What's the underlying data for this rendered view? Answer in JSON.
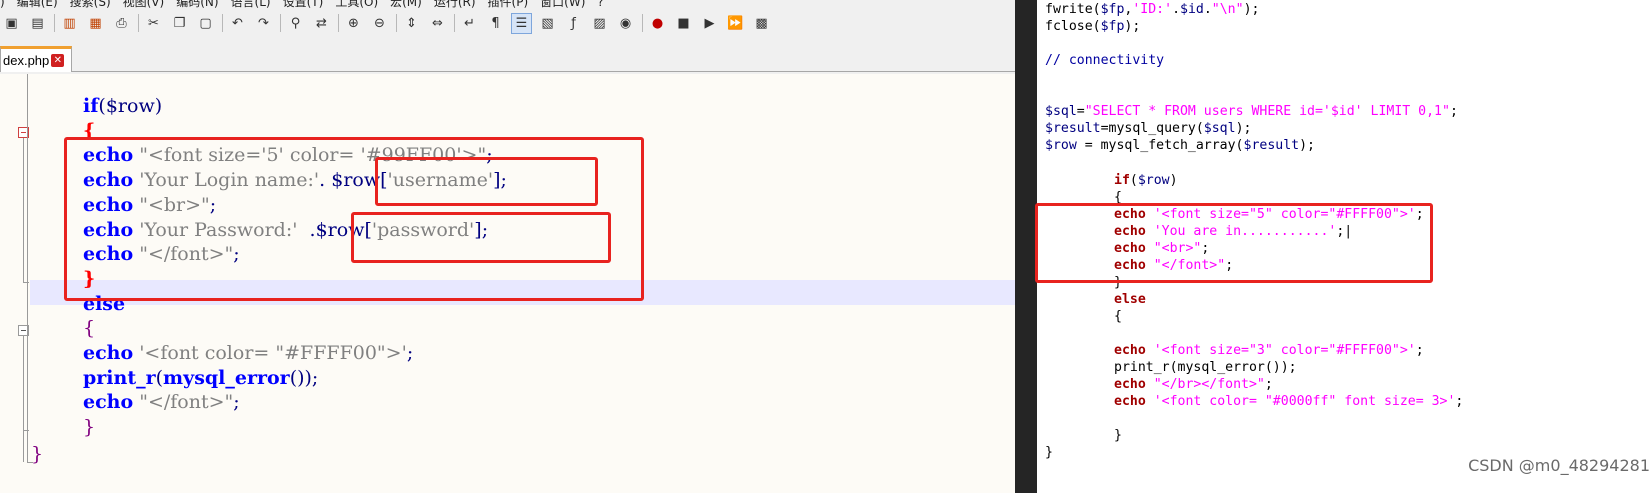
{
  "menubar": {
    "items": [
      ")",
      "编辑(E)",
      "搜索(S)",
      "视图(V)",
      "编码(N)",
      "语言(L)",
      "设置(T)",
      "工具(O)",
      "宏(M)",
      "运行(R)",
      "插件(P)",
      "窗口(W)",
      "?"
    ]
  },
  "toolbar": {
    "icons": [
      "save-icon",
      "save-all-icon",
      "close-icon",
      "close-all-icon",
      "print-icon",
      "cut-icon",
      "copy-icon",
      "paste-icon",
      "undo-icon",
      "redo-icon",
      "find-icon",
      "replace-icon",
      "zoom-in-icon",
      "zoom-out-icon",
      "sync-vertical-icon",
      "sync-horizontal-icon",
      "word-wrap-icon",
      "show-all-chars-icon",
      "indent-guide-icon",
      "doc-map-icon",
      "function-list-icon",
      "folder-workspace-icon",
      "monitor-icon",
      "record-macro-icon",
      "stop-macro-icon",
      "play-macro-icon",
      "run-macro-multiple-icon",
      "save-macro-icon"
    ]
  },
  "tab": {
    "label": "dex.php"
  },
  "editor": {
    "lines": [
      {
        "indent": "",
        "parts": [
          [
            "kw",
            "if"
          ],
          [
            "op",
            "("
          ],
          [
            "var",
            "$row"
          ],
          [
            "op",
            ")"
          ]
        ]
      },
      {
        "indent": "",
        "parts": [
          [
            "brace-red",
            "{"
          ]
        ]
      },
      {
        "indent": "",
        "parts": [
          [
            "kw",
            "echo"
          ],
          [
            "op",
            " "
          ],
          [
            "str",
            "\"<font size='5' color= '#99FF00'>\""
          ],
          [
            "op",
            ";"
          ]
        ]
      },
      {
        "indent": "",
        "parts": [
          [
            "kw",
            "echo"
          ],
          [
            "op",
            " "
          ],
          [
            "str",
            "'Your Login name:'"
          ],
          [
            "op",
            ". "
          ],
          [
            "var",
            "$row"
          ],
          [
            "op",
            "["
          ],
          [
            "str",
            "'username'"
          ],
          [
            "op",
            "];"
          ]
        ]
      },
      {
        "indent": "",
        "parts": [
          [
            "kw",
            "echo"
          ],
          [
            "op",
            " "
          ],
          [
            "str",
            "\"<br>\""
          ],
          [
            "op",
            ";"
          ]
        ]
      },
      {
        "indent": "",
        "parts": [
          [
            "kw",
            "echo"
          ],
          [
            "op",
            " "
          ],
          [
            "str",
            "'Your Password:' "
          ],
          [
            "op",
            " ."
          ],
          [
            "var",
            "$row"
          ],
          [
            "op",
            "["
          ],
          [
            "str",
            "'password'"
          ],
          [
            "op",
            "];"
          ]
        ]
      },
      {
        "indent": "",
        "parts": [
          [
            "kw",
            "echo"
          ],
          [
            "op",
            " "
          ],
          [
            "str",
            "\"</font>\""
          ],
          [
            "op",
            ";"
          ]
        ]
      },
      {
        "indent": "",
        "parts": [
          [
            "brace-red",
            "}"
          ]
        ]
      },
      {
        "indent": "",
        "parts": [
          [
            "kw",
            "else"
          ]
        ]
      },
      {
        "indent": "",
        "parts": [
          [
            "brace",
            "{"
          ]
        ]
      },
      {
        "indent": "",
        "parts": [
          [
            "kw",
            "echo"
          ],
          [
            "op",
            " "
          ],
          [
            "str",
            "'<font color= \"#FFFF00\">'"
          ],
          [
            "op",
            ";"
          ]
        ]
      },
      {
        "indent": "",
        "parts": [
          [
            "kw",
            "print_r"
          ],
          [
            "op",
            "("
          ],
          [
            "kw",
            "mysql_error"
          ],
          [
            "op",
            "());"
          ]
        ]
      },
      {
        "indent": "",
        "parts": [
          [
            "kw",
            "echo"
          ],
          [
            "op",
            " "
          ],
          [
            "str",
            "\"</font>\""
          ],
          [
            "op",
            ";"
          ]
        ]
      },
      {
        "indent": "",
        "parts": [
          [
            "brace",
            "}"
          ]
        ]
      }
    ],
    "last_brace": "}"
  },
  "right_panel": {
    "lines": [
      {
        "indent": 0,
        "parts": [
          [
            "rf",
            "fwrite("
          ],
          [
            "rv",
            "$fp"
          ],
          [
            "rf",
            ","
          ],
          [
            "rs",
            "'ID:'"
          ],
          [
            "rf",
            "."
          ],
          [
            "rv",
            "$id"
          ],
          [
            "rf",
            "."
          ],
          [
            "rs",
            "\"\\n\""
          ],
          [
            "rf",
            ");"
          ]
        ]
      },
      {
        "indent": 0,
        "parts": [
          [
            "rf",
            "fclose("
          ],
          [
            "rv",
            "$fp"
          ],
          [
            "rf",
            ");"
          ]
        ]
      },
      {
        "indent": 0,
        "parts": []
      },
      {
        "indent": 0,
        "parts": [
          [
            "rc",
            "// connectivity"
          ]
        ]
      },
      {
        "indent": 0,
        "parts": []
      },
      {
        "indent": 0,
        "parts": []
      },
      {
        "indent": 0,
        "parts": [
          [
            "rv",
            "$sql"
          ],
          [
            "rf",
            "="
          ],
          [
            "rs",
            "\"SELECT * FROM users WHERE id='$id' LIMIT 0,1\""
          ],
          [
            "rf",
            ";"
          ]
        ]
      },
      {
        "indent": 0,
        "parts": [
          [
            "rv",
            "$result"
          ],
          [
            "rf",
            "=mysql_query("
          ],
          [
            "rv",
            "$sql"
          ],
          [
            "rf",
            ");"
          ]
        ]
      },
      {
        "indent": 0,
        "parts": [
          [
            "rv",
            "$row"
          ],
          [
            "rf",
            " = mysql_fetch_array("
          ],
          [
            "rv",
            "$result"
          ],
          [
            "rf",
            ");"
          ]
        ]
      },
      {
        "indent": 0,
        "parts": []
      },
      {
        "indent": 1,
        "parts": [
          [
            "rk",
            "if"
          ],
          [
            "rf",
            "("
          ],
          [
            "rv",
            "$row"
          ],
          [
            "rf",
            ")"
          ]
        ]
      },
      {
        "indent": 1,
        "parts": [
          [
            "rf",
            "{"
          ]
        ]
      },
      {
        "indent": 1,
        "parts": [
          [
            "rk",
            "echo"
          ],
          [
            "rf",
            " "
          ],
          [
            "rs",
            "'<font size=\"5\" color=\"#FFFF00\">'"
          ],
          [
            "rf",
            ";"
          ]
        ]
      },
      {
        "indent": 1,
        "parts": [
          [
            "rk",
            "echo"
          ],
          [
            "rf",
            " "
          ],
          [
            "rs",
            "'You are in...........'"
          ],
          [
            "rf",
            ";|"
          ]
        ]
      },
      {
        "indent": 1,
        "parts": [
          [
            "rk",
            "echo"
          ],
          [
            "rf",
            " "
          ],
          [
            "rs",
            "\"<br>\""
          ],
          [
            "rf",
            ";"
          ]
        ]
      },
      {
        "indent": 1,
        "parts": [
          [
            "rk",
            "echo"
          ],
          [
            "rf",
            " "
          ],
          [
            "rs",
            "\"</font>\""
          ],
          [
            "rf",
            ";"
          ]
        ]
      },
      {
        "indent": 1,
        "parts": [
          [
            "rf",
            "}"
          ]
        ]
      },
      {
        "indent": 1,
        "parts": [
          [
            "rk",
            "else"
          ]
        ]
      },
      {
        "indent": 1,
        "parts": [
          [
            "rf",
            "{"
          ]
        ]
      },
      {
        "indent": 0,
        "parts": []
      },
      {
        "indent": 1,
        "parts": [
          [
            "rk",
            "echo"
          ],
          [
            "rf",
            " "
          ],
          [
            "rs",
            "'<font size=\"3\" color=\"#FFFF00\">'"
          ],
          [
            "rf",
            ";"
          ]
        ]
      },
      {
        "indent": 1,
        "parts": [
          [
            "rf",
            "print_r(mysql_error());"
          ]
        ]
      },
      {
        "indent": 1,
        "parts": [
          [
            "rk",
            "echo"
          ],
          [
            "rf",
            " "
          ],
          [
            "rs",
            "\"</br></font>\""
          ],
          [
            "rf",
            ";"
          ]
        ]
      },
      {
        "indent": 1,
        "parts": [
          [
            "rk",
            "echo"
          ],
          [
            "rf",
            " "
          ],
          [
            "rs",
            "'<font color= \"#0000ff\" font size= 3>'"
          ],
          [
            "rf",
            ";"
          ]
        ]
      },
      {
        "indent": 0,
        "parts": []
      },
      {
        "indent": 1,
        "parts": [
          [
            "rf",
            "}"
          ]
        ]
      },
      {
        "indent": 0,
        "parts": [
          [
            "rf",
            "}"
          ]
        ]
      }
    ]
  },
  "watermark": "CSDN @m0_48294281",
  "colors": {
    "annotation": "#e8231f",
    "keyword_left": "#0000ff",
    "string_left": "#808080",
    "string_right": "#ff00ff",
    "keyword_right": "#a00000"
  }
}
